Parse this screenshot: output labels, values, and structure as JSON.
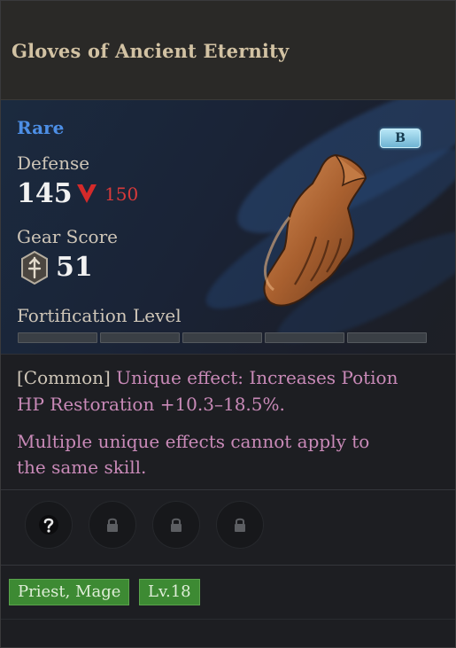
{
  "item": {
    "name": "Gloves of Ancient Eternity",
    "rarity": "Rare",
    "grade_badge": "B",
    "rarity_color": "#4d8fe6"
  },
  "stats": {
    "defense_label": "Defense",
    "defense_value": "145",
    "defense_compare": "150",
    "gear_score_label": "Gear Score",
    "gear_score_value": "51",
    "fortification_label": "Fortification Level",
    "fortification_filled": 0,
    "fortification_segments": 5
  },
  "effects": {
    "tag": "[Common]",
    "unique_line1": "Unique effect: Increases Potion",
    "unique_line2": "HP Restoration +10.3–18.5%.",
    "note_line1": "Multiple unique effects cannot apply to",
    "note_line2": "the same skill."
  },
  "sockets": [
    {
      "icon": "question-icon",
      "state": "unknown"
    },
    {
      "icon": "lock-icon",
      "state": "locked"
    },
    {
      "icon": "lock-icon",
      "state": "locked"
    },
    {
      "icon": "lock-icon",
      "state": "locked"
    }
  ],
  "requirements": {
    "classes": "Priest, Mage",
    "level": "Lv.18",
    "tag_color": "#3d8a33"
  },
  "icons": {
    "defense_compare": "down-arrow-icon",
    "gear_score": "sword-shield-icon",
    "item_image": "glove-icon"
  }
}
